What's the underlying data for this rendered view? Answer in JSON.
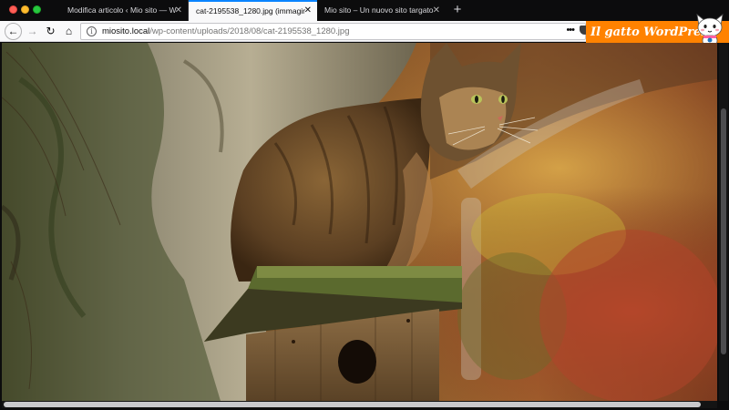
{
  "window": {
    "controls": [
      "close",
      "minimize",
      "zoom"
    ]
  },
  "tabs": [
    {
      "title": "Modifica articolo ‹ Mio sito — WordPress",
      "active": false,
      "close": "✕"
    },
    {
      "title": "cat-2195538_1280.jpg (immagine JPEG",
      "active": true,
      "close": "✕"
    },
    {
      "title": "Mio sito – Un nuovo sito targato WordPress",
      "active": false,
      "close": "✕"
    }
  ],
  "new_tab": "+",
  "nav": {
    "back": "←",
    "forward": "→",
    "reload": "↻",
    "home": "⌂"
  },
  "urlbar": {
    "host": "miosito.local",
    "path": "/wp-content/uploads/2018/08/cat-2195538_1280.jpg",
    "menu": "•••"
  },
  "logo": {
    "text": "Il gatto WordPress",
    "icon": "cat-mascot-icon"
  },
  "content": {
    "image": "photo of a tabby cat sitting on a wooden birdhouse next to a tree trunk",
    "colors": {
      "accent": "#0a84ff",
      "logo_bg": "#ff8200",
      "chrome_dark": "#0c0c0d",
      "toolbar": "#f9f9fa"
    }
  }
}
